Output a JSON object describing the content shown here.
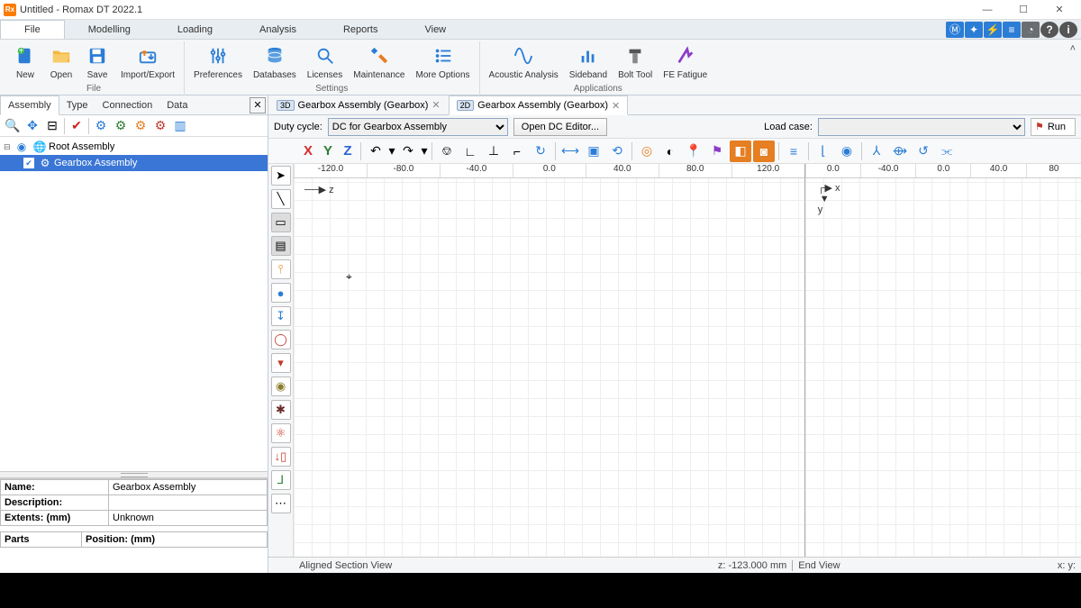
{
  "titlebar": {
    "app_icon_text": "Rx",
    "title": "Untitled - Romax DT 2022.1"
  },
  "menu": {
    "items": [
      "File",
      "Modelling",
      "Loading",
      "Analysis",
      "Reports",
      "View"
    ],
    "active_index": 0
  },
  "ribbon": {
    "file_group": {
      "label": "File",
      "buttons": [
        {
          "id": "new",
          "label": "New"
        },
        {
          "id": "open",
          "label": "Open"
        },
        {
          "id": "save",
          "label": "Save"
        },
        {
          "id": "import-export",
          "label": "Import/Export"
        }
      ]
    },
    "settings_group": {
      "label": "Settings",
      "buttons": [
        {
          "id": "preferences",
          "label": "Preferences"
        },
        {
          "id": "databases",
          "label": "Databases"
        },
        {
          "id": "licenses",
          "label": "Licenses"
        },
        {
          "id": "maintenance",
          "label": "Maintenance"
        },
        {
          "id": "more-options",
          "label": "More Options"
        }
      ]
    },
    "applications_group": {
      "label": "Applications",
      "buttons": [
        {
          "id": "acoustic-analysis",
          "label": "Acoustic Analysis"
        },
        {
          "id": "sideband",
          "label": "Sideband"
        },
        {
          "id": "bolt-tool",
          "label": "Bolt Tool"
        },
        {
          "id": "fe-fatigue",
          "label": "FE Fatigue"
        }
      ]
    }
  },
  "left_panel": {
    "tabs": [
      "Assembly",
      "Type",
      "Connection",
      "Data"
    ],
    "active_tab": 0,
    "tree": {
      "root": {
        "label": "Root Assembly"
      },
      "child": {
        "label": "Gearbox Assembly"
      }
    },
    "props": {
      "name_label": "Name:",
      "name_value": "Gearbox Assembly",
      "desc_label": "Description:",
      "desc_value": "",
      "extents_label": "Extents: (mm)",
      "extents_value": "Unknown",
      "parts_label": "Parts",
      "position_label": "Position: (mm)"
    }
  },
  "doc_tabs": [
    {
      "badge": "3D",
      "label": "Gearbox Assembly (Gearbox)"
    },
    {
      "badge": "2D",
      "label": "Gearbox Assembly (Gearbox)"
    }
  ],
  "doc_active_tab": 1,
  "doc_toolbar": {
    "duty_label": "Duty cycle:",
    "duty_value": "DC for Gearbox Assembly",
    "open_dc_btn": "Open DC Editor...",
    "loadcase_label": "Load case:",
    "loadcase_value": "",
    "run_btn": "Run"
  },
  "view_toolbar2": {
    "x": "X",
    "y": "Y",
    "z": "Z"
  },
  "ruler_left": [
    "-120.0",
    "-80.0",
    "-40.0",
    "0.0",
    "40.0",
    "80.0",
    "120.0"
  ],
  "ruler_right": [
    "0.0",
    "-40.0",
    "0.0",
    "40.0",
    "80"
  ],
  "axis_left": "z",
  "axis_right_x": "x",
  "axis_right_y": "y",
  "status": {
    "left_label": "Aligned Section View",
    "left_coord": "z: -123.000 mm",
    "right_label": "End View",
    "right_coord": "x:  y:"
  },
  "colors": {
    "accent_blue": "#2b7dd6",
    "selection": "#3a76d6"
  }
}
